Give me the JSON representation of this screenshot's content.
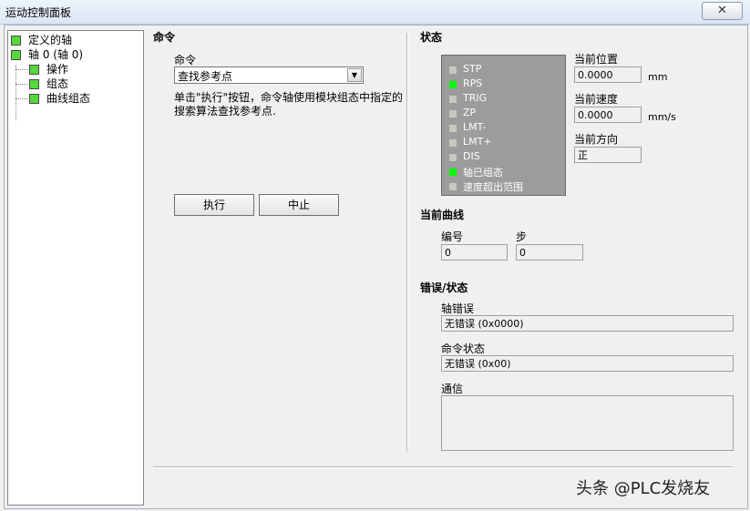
{
  "window": {
    "title": "运动控制面板",
    "close_icon": "✕"
  },
  "tree": {
    "items": [
      {
        "label": "定义的轴"
      },
      {
        "label": "轴 0 (轴 0)"
      },
      {
        "label": "操作"
      },
      {
        "label": "组态"
      },
      {
        "label": "曲线组态"
      }
    ]
  },
  "command": {
    "section_title": "命令",
    "field_label": "命令",
    "selected": "查找参考点",
    "description_line1": "单击\"执行\"按钮，命令轴使用模块组态中指定的",
    "description_line2": "搜索算法查找参考点.",
    "execute_label": "执行",
    "abort_label": "中止"
  },
  "status": {
    "section_title": "状态",
    "leds": [
      {
        "label": "STP",
        "on": false
      },
      {
        "label": "RPS",
        "on": true
      },
      {
        "label": "TRIG",
        "on": false
      },
      {
        "label": "ZP",
        "on": false
      },
      {
        "label": "LMT-",
        "on": false
      },
      {
        "label": "LMT+",
        "on": false
      },
      {
        "label": "DIS",
        "on": false
      },
      {
        "label": "轴已组态",
        "on": true
      },
      {
        "label": "速度超出范围",
        "on": false
      }
    ],
    "colors": {
      "on": "#00ff00",
      "off": "#c8c8c0"
    },
    "position_label": "当前位置",
    "position_value": "0.0000",
    "position_unit": "mm",
    "speed_label": "当前速度",
    "speed_value": "0.0000",
    "speed_unit": "mm/s",
    "direction_label": "当前方向",
    "direction_value": "正"
  },
  "curve": {
    "section_title": "当前曲线",
    "number_label": "编号",
    "number_value": "0",
    "step_label": "步",
    "step_value": "0"
  },
  "errors": {
    "section_title": "错误/状态",
    "axis_error_label": "轴错误",
    "axis_error_value": "无错误 (0x0000)",
    "command_status_label": "命令状态",
    "command_status_value": "无错误 (0x00)",
    "comm_label": "通信",
    "comm_value": ""
  },
  "watermark": "头条 @PLC发烧友"
}
